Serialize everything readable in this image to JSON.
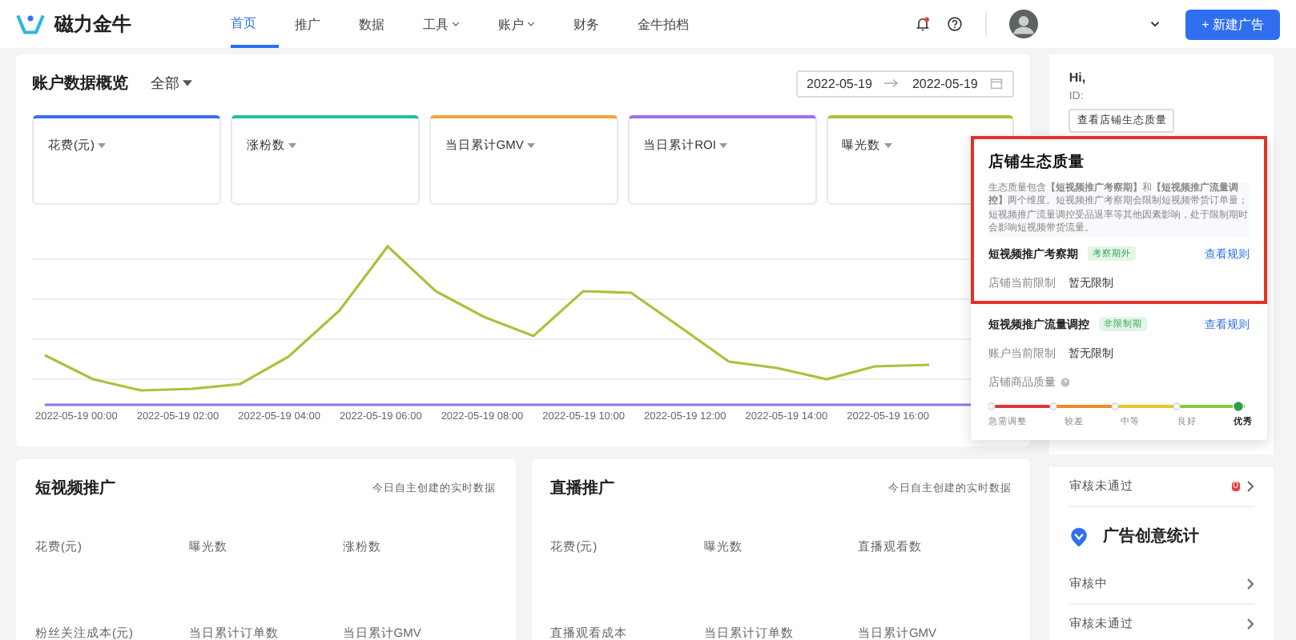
{
  "nav": {
    "brand": "磁力金牛",
    "items": [
      {
        "label": "首页",
        "selected": true,
        "dropdown": false
      },
      {
        "label": "推广",
        "selected": false,
        "dropdown": false
      },
      {
        "label": "数据",
        "selected": false,
        "dropdown": false
      },
      {
        "label": "工具",
        "selected": false,
        "dropdown": true
      },
      {
        "label": "账户",
        "selected": false,
        "dropdown": true
      },
      {
        "label": "财务",
        "selected": false,
        "dropdown": false
      },
      {
        "label": "金牛拍档",
        "selected": false,
        "dropdown": false
      }
    ],
    "notification_dot": true,
    "new_button": "+ 新建广告"
  },
  "overview": {
    "title": "账户数据概览",
    "filter": "全部",
    "date_start": "2022-05-19",
    "date_end": "2022-05-19",
    "metrics": [
      {
        "label": "花费(元)",
        "color": "#3a6ff0"
      },
      {
        "label": "涨粉数",
        "color": "#22bfa0"
      },
      {
        "label": "当日累计GMV",
        "color": "#f2a33a"
      },
      {
        "label": "当日累计ROI",
        "color": "#9c70ef"
      },
      {
        "label": "曝光数",
        "color": "#a9c23c"
      }
    ],
    "x_axis_labels": [
      "2022-05-19 00:00",
      "2022-05-19 02:00",
      "2022-05-19 04:00",
      "2022-05-19 06:00",
      "2022-05-19 08:00",
      "2022-05-19 10:00",
      "2022-05-19 12:00",
      "2022-05-19 14:00",
      "2022-05-19 16:00"
    ]
  },
  "sections": [
    {
      "title": "短视频推广",
      "note": "今日自主创建的实时数据",
      "fields": [
        "花费(元)",
        "曝光数",
        "涨粉数",
        "粉丝关注成本(元)",
        "当日累计订单数",
        "当日累计GMV"
      ]
    },
    {
      "title": "直播推广",
      "note": "今日自主创建的实时数据",
      "fields": [
        "花费(元)",
        "曝光数",
        "直播观看数",
        "直播观看成本",
        "当日累计订单数",
        "当日累计GMV"
      ]
    }
  ],
  "sidebar": {
    "greeting": "Hi,",
    "id_label": "ID:",
    "quality_button": "查看店铺生态质量",
    "rows_top": [
      {
        "label": "审核未通过",
        "badge": "0"
      }
    ],
    "creative_title": "广告创意统计",
    "rows": [
      {
        "label": "审核中"
      },
      {
        "label": "审核未通过"
      }
    ]
  },
  "popup": {
    "title": "店铺生态质量",
    "description": "生态质量包含**【短视频推广考察期】**和**【短视频推广流量调控】**两个维度。短视频推广考察期会限制短视频带货订单量；短视频推广流量调控受品退率等其他因素影响，处于限制期时会影响短视频带货流量。",
    "highlighted": true,
    "blocks": [
      {
        "title": "短视频推广考察期",
        "tag": "考察期外",
        "link": "查看规则",
        "limit_label": "店铺当前限制",
        "limit_value": "暂无限制"
      },
      {
        "title": "短视频推广流量调控",
        "tag": "非限制期",
        "link": "查看规则",
        "limit_label": "账户当前限制",
        "limit_value": "暂无限制"
      }
    ],
    "quality_label": "店铺商品质量",
    "grades": [
      {
        "label": "急需调整",
        "selected": false
      },
      {
        "label": "较差",
        "selected": false
      },
      {
        "label": "中等",
        "selected": false
      },
      {
        "label": "良好",
        "selected": false
      },
      {
        "label": "优秀",
        "selected": true
      }
    ]
  }
}
